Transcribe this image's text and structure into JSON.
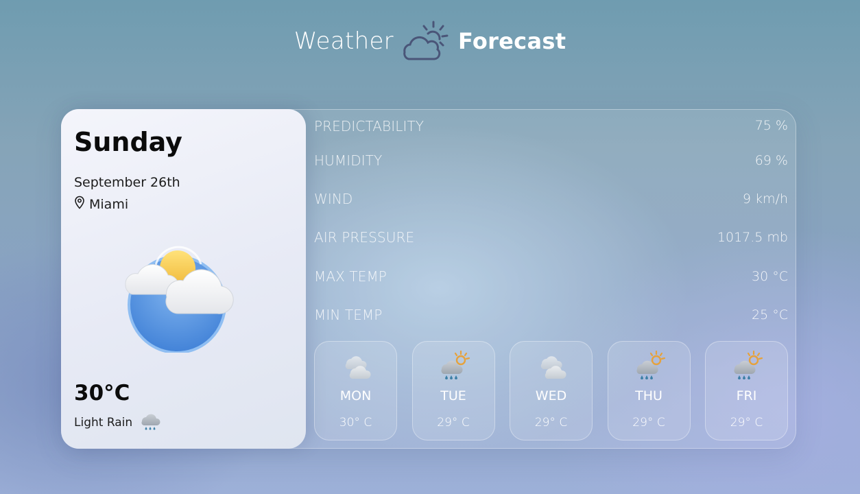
{
  "header": {
    "title_part1": "Weather",
    "title_part2": "Forecast",
    "logo_icon": "cloud-sun-icon"
  },
  "current": {
    "day": "Sunday",
    "date": "September 26th",
    "location": "Miami",
    "location_icon": "map-pin-icon",
    "main_icon": "sun-behind-clouds-icon",
    "temperature": "30°C",
    "condition": "Light Rain",
    "condition_icon": "rain-cloud-icon"
  },
  "stats": [
    {
      "label": "PREDICTABILITY",
      "value": "75 %"
    },
    {
      "label": "HUMIDITY",
      "value": "69 %"
    },
    {
      "label": "WIND",
      "value": "9 km/h"
    },
    {
      "label": "AIR PRESSURE",
      "value": "1017.5 mb"
    },
    {
      "label": "MAX TEMP",
      "value": "30 °C"
    },
    {
      "label": "MIN TEMP",
      "value": "25 °C"
    }
  ],
  "forecast": [
    {
      "day": "MON",
      "temp": "30° C",
      "icon": "clouds-icon"
    },
    {
      "day": "TUE",
      "temp": "29° C",
      "icon": "sun-rain-cloud-icon"
    },
    {
      "day": "WED",
      "temp": "29° C",
      "icon": "clouds-icon"
    },
    {
      "day": "THU",
      "temp": "29° C",
      "icon": "sun-rain-cloud-icon"
    },
    {
      "day": "FRI",
      "temp": "29° C",
      "icon": "sun-rain-cloud-icon"
    }
  ],
  "colors": {
    "accent_logo": "#4a5578",
    "sun": "#f2c94c",
    "sun_orange": "#e6a23c",
    "rain_drop": "#3d7fa6",
    "circle_blue": "#4f8fdc"
  }
}
